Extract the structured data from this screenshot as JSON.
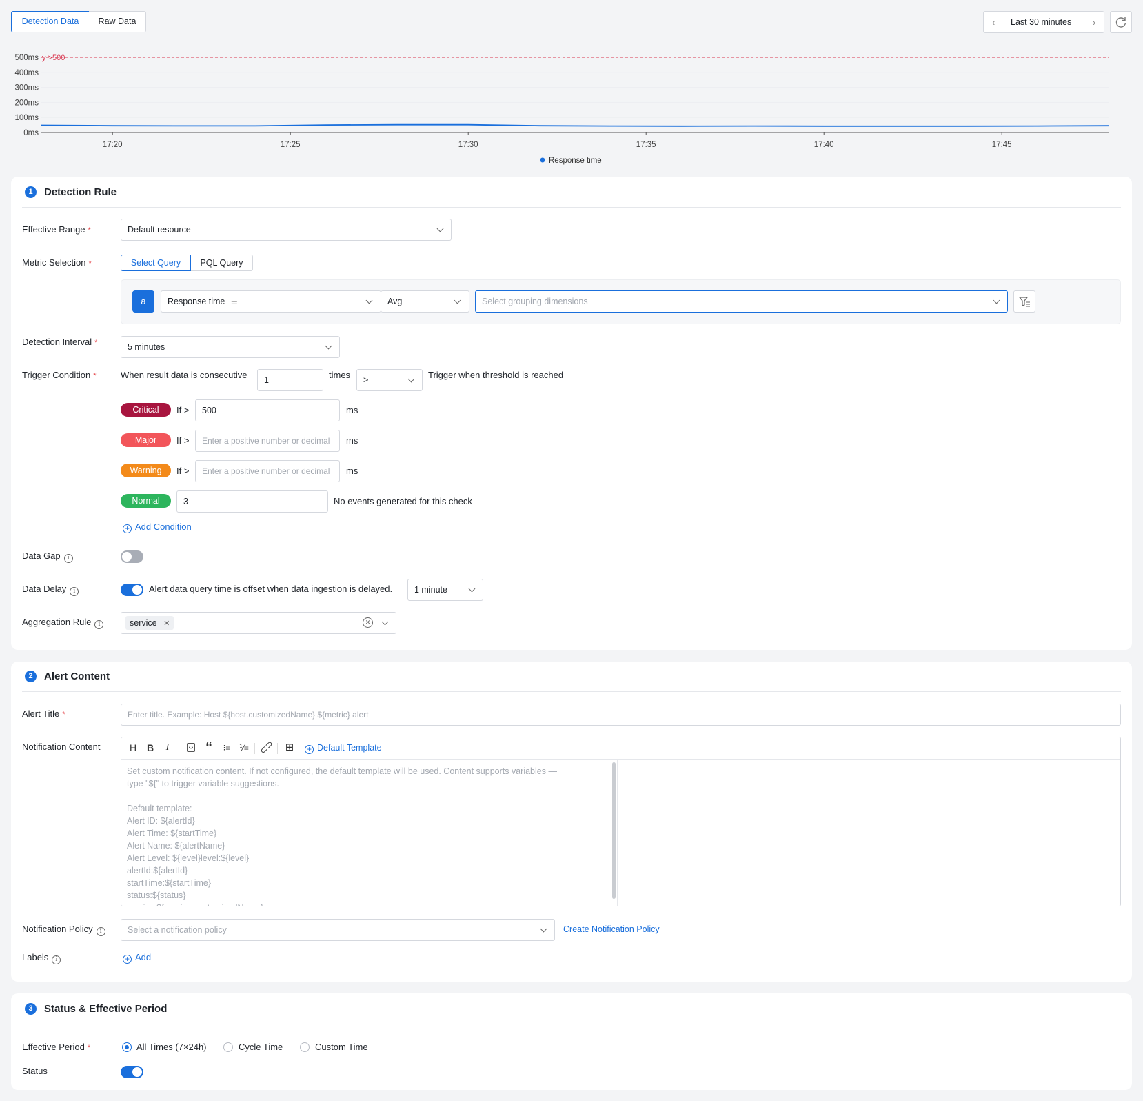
{
  "tabs": {
    "detection": "Detection Data",
    "raw": "Raw Data"
  },
  "time_range": {
    "label": "Last 30 minutes"
  },
  "chart_data": {
    "type": "line",
    "x": [
      "17:18",
      "17:20",
      "17:22",
      "17:24",
      "17:26",
      "17:28",
      "17:30",
      "17:32",
      "17:34",
      "17:36",
      "17:38",
      "17:40",
      "17:42",
      "17:44",
      "17:46",
      "17:48"
    ],
    "series": [
      {
        "name": "Response time",
        "values": [
          48,
          45,
          44,
          44,
          50,
          52,
          52,
          45,
          43,
          42,
          43,
          42,
          42,
          42,
          43,
          45
        ],
        "color": "#1a6fdc"
      }
    ],
    "x_ticks": [
      "17:20",
      "17:25",
      "17:30",
      "17:35",
      "17:40",
      "17:45"
    ],
    "y_ticks": [
      "0ms",
      "100ms",
      "200ms",
      "300ms",
      "400ms",
      "500ms"
    ],
    "ylim": [
      0,
      500
    ],
    "threshold": {
      "value": 500,
      "label": "y >500",
      "color": "#d9364f"
    },
    "legend": {
      "position": "bottom"
    },
    "grid": true
  },
  "detection_rule": {
    "step": "1",
    "title": "Detection Rule",
    "effective_range": {
      "label": "Effective Range",
      "value": "Default resource"
    },
    "metric_selection": {
      "label": "Metric Selection",
      "mode_select": "Select Query",
      "mode_pql": "PQL Query",
      "query_letter": "a",
      "metric": "Response time",
      "aggregate": "Avg",
      "grouping_placeholder": "Select grouping dimensions"
    },
    "detection_interval": {
      "label": "Detection Interval",
      "value": "5 minutes"
    },
    "trigger": {
      "label": "Trigger Condition",
      "prefix": "When result data is consecutive",
      "count": "1",
      "times": "times",
      "operator": ">",
      "suffix": "Trigger when threshold is reached",
      "if_label": "If >",
      "unit": "ms",
      "levels": {
        "critical": {
          "name": "Critical",
          "value": "500",
          "color": "#a8153f"
        },
        "major": {
          "name": "Major",
          "placeholder": "Enter a positive number or decimal",
          "color": "#f2555a"
        },
        "warning": {
          "name": "Warning",
          "placeholder": "Enter a positive number or decimal",
          "color": "#f38a1a"
        },
        "normal": {
          "name": "Normal",
          "value": "3",
          "note": "No events generated for this check",
          "color": "#2db55d"
        }
      },
      "add_condition": "Add Condition"
    },
    "data_gap": {
      "label": "Data Gap",
      "enabled": false
    },
    "data_delay": {
      "label": "Data Delay",
      "enabled": true,
      "text": "Alert data query time is offset when data ingestion is delayed.",
      "value": "1 minute"
    },
    "aggregation_rule": {
      "label": "Aggregation Rule",
      "tag": "service"
    }
  },
  "alert_content": {
    "step": "2",
    "title": "Alert Content",
    "alert_title": {
      "label": "Alert Title",
      "placeholder": "Enter title. Example: Host ${host.customizedName} ${metric} alert"
    },
    "notification_content": {
      "label": "Notification Content",
      "default_template": "Default Template",
      "placeholder_lines": [
        "Set custom notification content. If not configured, the default template will be used. Content supports variables —",
        "type \"${\" to trigger variable suggestions.",
        "",
        "Default template:",
        "Alert ID: ${alertId}",
        "Alert Time: ${startTime}",
        "Alert Name: ${alertName}",
        "Alert Level: ${level}level:${level}",
        "alertId:${alertId}",
        "startTime:${startTime}",
        "status:${status}",
        "service:${service.customizedName}"
      ]
    },
    "notification_policy": {
      "label": "Notification Policy",
      "placeholder": "Select a notification policy",
      "create": "Create Notification Policy"
    },
    "labels": {
      "label": "Labels",
      "add": "Add"
    }
  },
  "status_section": {
    "step": "3",
    "title": "Status & Effective Period",
    "effective_period": {
      "label": "Effective Period",
      "options": [
        "All Times (7×24h)",
        "Cycle Time",
        "Custom Time"
      ],
      "selected": "All Times (7×24h)"
    },
    "status": {
      "label": "Status",
      "enabled": true
    }
  }
}
